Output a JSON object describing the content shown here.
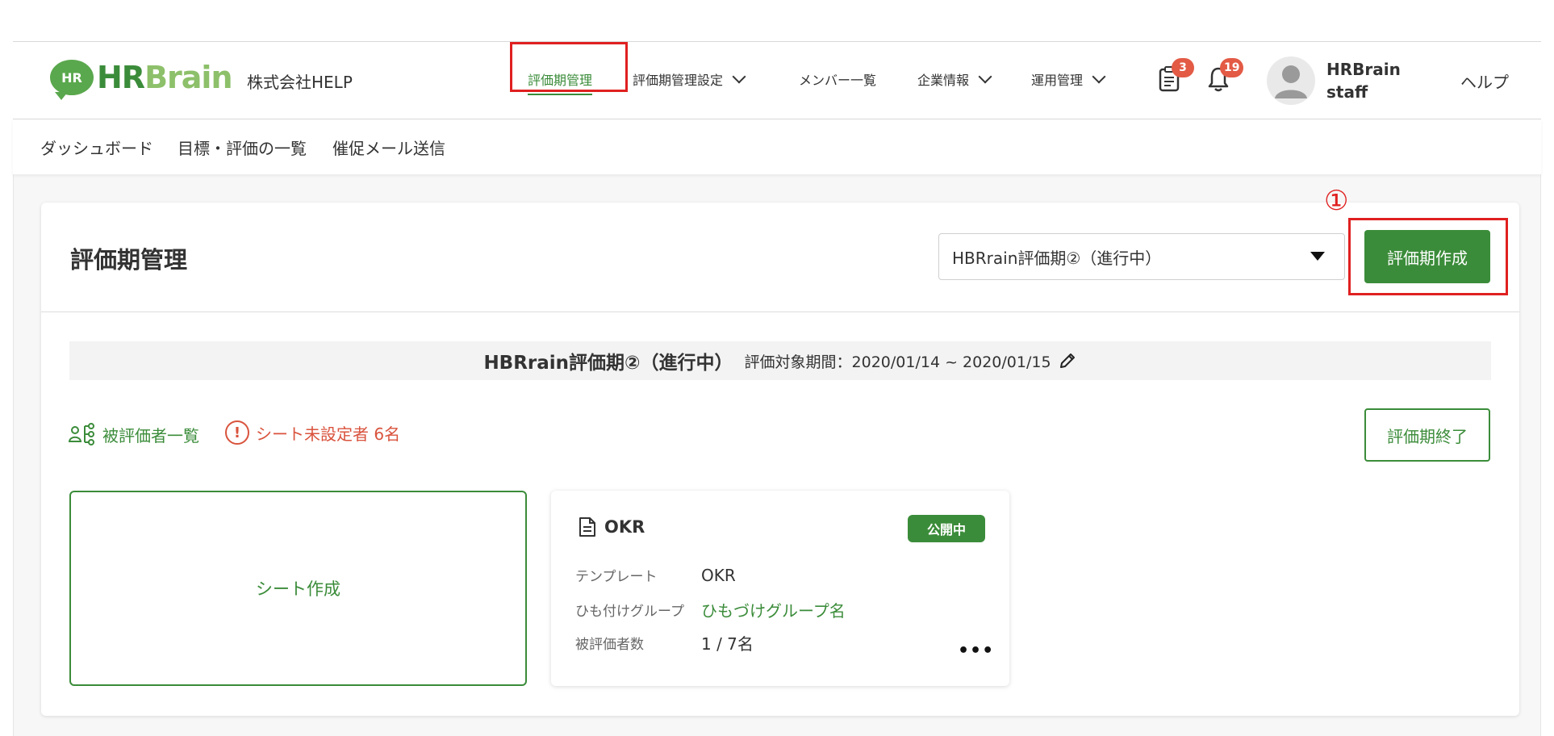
{
  "header": {
    "logo_badge": "HR",
    "logo_hr": "HR",
    "logo_brain": "Brain",
    "company": "株式会社HELP",
    "nav": [
      {
        "label": "評価期管理"
      },
      {
        "label": "評価期管理設定"
      },
      {
        "label": "メンバー一覧"
      },
      {
        "label": "企業情報"
      },
      {
        "label": "運用管理"
      }
    ],
    "tasks_badge": "3",
    "notifications_badge": "19",
    "user_line1": "HRBrain",
    "user_line2": "staff",
    "help": "ヘルプ"
  },
  "subnav": {
    "items": [
      "ダッシュボード",
      "目標・評価の一覧",
      "催促メール送信"
    ]
  },
  "main": {
    "title": "評価期管理",
    "period_select": "HBRrain評価期②（進行中）",
    "create_button": "評価期作成",
    "annotation": "①",
    "period_name": "HBRrain評価期②（進行中）",
    "period_range": "評価対象期間：2020/01/14 ~ 2020/01/15",
    "evaluees_link": "被評価者一覧",
    "warning": "シート未設定者 6名",
    "end_button": "評価期終了",
    "sheet_create": "シート作成",
    "sheet": {
      "title": "OKR",
      "status": "公開中",
      "template_label": "テンプレート",
      "template_value": "OKR",
      "group_label": "ひも付けグループ",
      "group_value": "ひもづけグループ名",
      "count_label": "被評価者数",
      "count_value": "1 / 7名",
      "more": "•••"
    }
  },
  "colors": {
    "brand_green": "#3b8c3a",
    "warning_red": "#d9533d",
    "badge_red": "#e35a45",
    "highlight_red": "#e02020"
  }
}
